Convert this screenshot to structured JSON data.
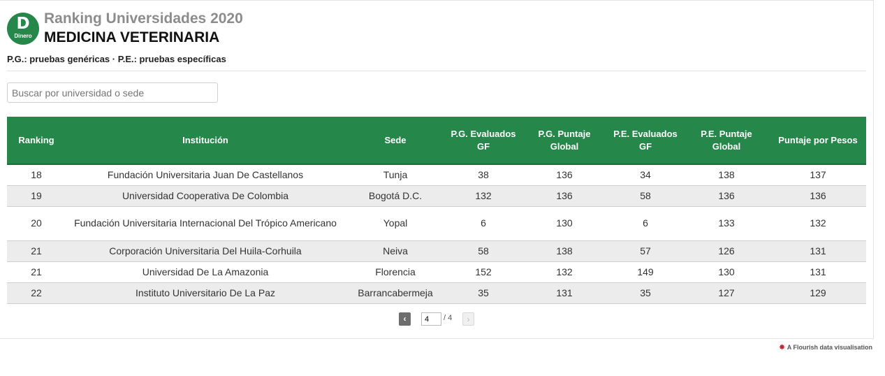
{
  "header": {
    "logo_letter": "D",
    "logo_text": "Dinero",
    "supertitle": "Ranking Universidades 2020",
    "title": "MEDICINA VETERINARIA",
    "subtitle": "P.G.: pruebas genéricas · P.E.: pruebas específicas"
  },
  "search": {
    "placeholder": "Buscar por universidad o sede",
    "value": ""
  },
  "colors": {
    "header_green": "#25874a",
    "row_alt": "#ececec",
    "brand_red": "#d3202a"
  },
  "table": {
    "columns": [
      "Ranking",
      "Institución",
      "Sede",
      "P.G. Evaluados GF",
      "P.G. Puntaje Global",
      "P.E. Evaluados GF",
      "P.E. Puntaje Global",
      "Puntaje por Pesos"
    ],
    "rows": [
      [
        "18",
        "Fundación Universitaria Juan De Castellanos",
        "Tunja",
        "38",
        "136",
        "34",
        "138",
        "137"
      ],
      [
        "19",
        "Universidad Cooperativa De Colombia",
        "Bogotá D.C.",
        "132",
        "136",
        "58",
        "136",
        "136"
      ],
      [
        "20",
        "Fundación Universitaria Internacional Del Trópico Americano",
        "Yopal",
        "6",
        "130",
        "6",
        "133",
        "132"
      ],
      [
        "21",
        "Corporación Universitaria Del Huila-Corhuila",
        "Neiva",
        "58",
        "138",
        "57",
        "126",
        "131"
      ],
      [
        "21",
        "Universidad De La Amazonia",
        "Florencia",
        "152",
        "132",
        "149",
        "130",
        "131"
      ],
      [
        "22",
        "Instituto Universitario De La Paz",
        "Barrancabermeja",
        "35",
        "131",
        "35",
        "127",
        "129"
      ]
    ]
  },
  "pagination": {
    "prev_icon": "chevron-left-icon",
    "next_icon": "chevron-right-icon",
    "current": "4",
    "total_label": "/ 4"
  },
  "footer": {
    "credit": "A Flourish data visualisation",
    "icon": "flourish-logo-icon"
  }
}
